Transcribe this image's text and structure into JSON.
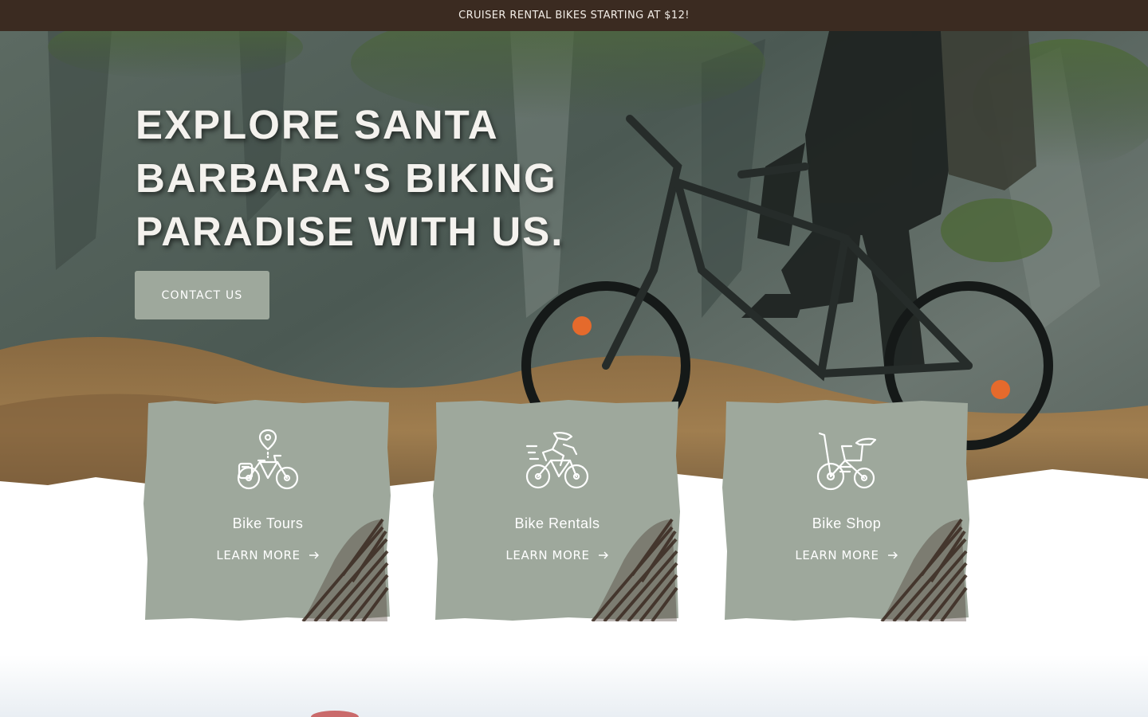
{
  "announcement": {
    "text": "CRUISER RENTAL BIKES STARTING AT $12!"
  },
  "hero": {
    "headline": "EXPLORE SANTA BARBARA'S BIKING PARADISE WITH US.",
    "cta_label": "CONTACT US"
  },
  "cards": [
    {
      "title": "Bike Tours",
      "link_label": "LEARN MORE",
      "icon": "bike-location-pin-icon"
    },
    {
      "title": "Bike Rentals",
      "link_label": "LEARN MORE",
      "icon": "cyclist-icon"
    },
    {
      "title": "Bike Shop",
      "link_label": "LEARN MORE",
      "icon": "bicycle-icon"
    }
  ],
  "colors": {
    "announcement_bg": "#3b2b21",
    "card_bg": "#9ea89c",
    "button_bg": "#9ea89c",
    "text_light": "#ffffff"
  }
}
